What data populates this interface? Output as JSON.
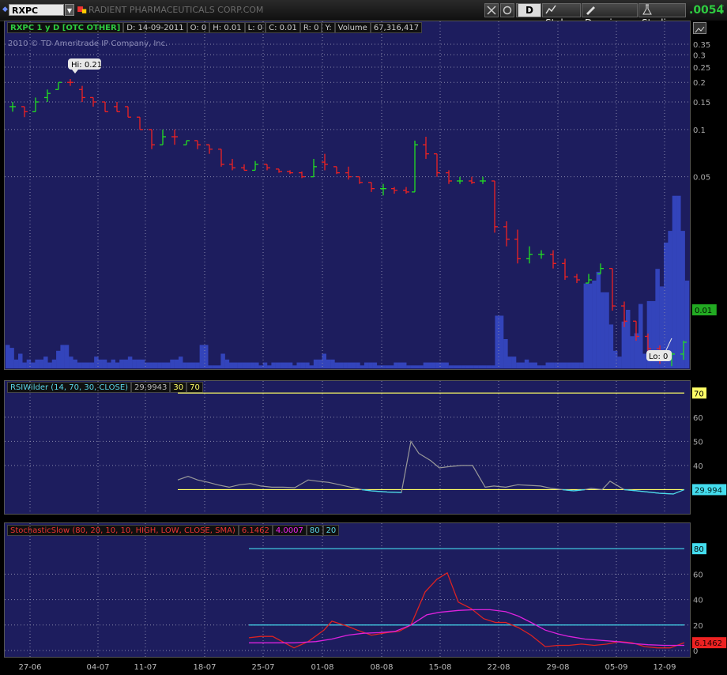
{
  "toolbar": {
    "symbol": "RXPC",
    "company": "RADIENT PHARMACEUTICALS CORP.COM",
    "period_button": "D",
    "style_label": "Style",
    "drawings_label": "Drawings",
    "studies_label": "Studies",
    "last_price": ".0054"
  },
  "header": {
    "title": "RXPC 1 y D [OTC OTHER]",
    "date": "D: 14-09-2011",
    "open": "O: 0",
    "high": "H: 0.01",
    "low": "L: 0",
    "close": "C: 0.01",
    "r": "R: 0",
    "y": "Y:",
    "volume_label": "Volume",
    "volume_value": "67,316,417",
    "copyright": "2010 © TD Ameritrade IP Company, Inc."
  },
  "colors": {
    "panel_bg": "#1d1d5e",
    "up": "#22dd22",
    "down": "#ee2222",
    "volume": "#3344bb",
    "rsi_line": "#999999",
    "stoch_k": "#dd2222",
    "stoch_d": "#dd22dd",
    "threshold_yellow": "#ffff66",
    "threshold_cyan": "#44ddee"
  },
  "chart_data": [
    {
      "type": "ohlc",
      "name": "price",
      "x_ticks": [
        "27-06",
        "04-07",
        "11-07",
        "18-07",
        "25-07",
        "01-08",
        "08-08",
        "15-08",
        "22-08",
        "29-08",
        "05-09",
        "12-09"
      ],
      "y_ticks": [
        "0.35",
        "0.3",
        "0.25",
        "0.2",
        "0.15",
        "0.1",
        "0.05"
      ],
      "y_scale": "log",
      "annotations": {
        "hi": "Hi: 0.21",
        "lo": "Lo: 0"
      },
      "last_label": "0.01",
      "candles": [
        {
          "x": 16,
          "o": 0.14,
          "h": 0.15,
          "l": 0.13,
          "c": 0.14,
          "u": 1
        },
        {
          "x": 31,
          "o": 0.14,
          "h": 0.14,
          "l": 0.12,
          "c": 0.13,
          "u": 0
        },
        {
          "x": 45,
          "o": 0.13,
          "h": 0.16,
          "l": 0.13,
          "c": 0.15,
          "u": 1
        },
        {
          "x": 60,
          "o": 0.16,
          "h": 0.18,
          "l": 0.15,
          "c": 0.17,
          "u": 1
        },
        {
          "x": 74,
          "o": 0.18,
          "h": 0.2,
          "l": 0.18,
          "c": 0.2,
          "u": 1
        },
        {
          "x": 89,
          "o": 0.2,
          "h": 0.21,
          "l": 0.19,
          "c": 0.2,
          "u": 0
        },
        {
          "x": 104,
          "o": 0.18,
          "h": 0.19,
          "l": 0.15,
          "c": 0.16,
          "u": 0
        },
        {
          "x": 118,
          "o": 0.16,
          "h": 0.16,
          "l": 0.14,
          "c": 0.15,
          "u": 0
        },
        {
          "x": 133,
          "o": 0.15,
          "h": 0.15,
          "l": 0.13,
          "c": 0.13,
          "u": 0
        },
        {
          "x": 148,
          "o": 0.14,
          "h": 0.15,
          "l": 0.13,
          "c": 0.13,
          "u": 0
        },
        {
          "x": 162,
          "o": 0.14,
          "h": 0.14,
          "l": 0.12,
          "c": 0.12,
          "u": 0
        },
        {
          "x": 177,
          "o": 0.12,
          "h": 0.12,
          "l": 0.1,
          "c": 0.1,
          "u": 0
        },
        {
          "x": 192,
          "o": 0.1,
          "h": 0.1,
          "l": 0.075,
          "c": 0.08,
          "u": 0
        },
        {
          "x": 206,
          "o": 0.08,
          "h": 0.1,
          "l": 0.08,
          "c": 0.09,
          "u": 1
        },
        {
          "x": 221,
          "o": 0.09,
          "h": 0.1,
          "l": 0.08,
          "c": 0.09,
          "u": 0
        },
        {
          "x": 236,
          "o": 0.08,
          "h": 0.085,
          "l": 0.08,
          "c": 0.085,
          "u": 1
        },
        {
          "x": 250,
          "o": 0.085,
          "h": 0.085,
          "l": 0.075,
          "c": 0.08,
          "u": 0
        },
        {
          "x": 265,
          "o": 0.08,
          "h": 0.08,
          "l": 0.07,
          "c": 0.075,
          "u": 0
        },
        {
          "x": 280,
          "o": 0.075,
          "h": 0.075,
          "l": 0.058,
          "c": 0.06,
          "u": 0
        },
        {
          "x": 294,
          "o": 0.06,
          "h": 0.065,
          "l": 0.055,
          "c": 0.057,
          "u": 0
        },
        {
          "x": 309,
          "o": 0.057,
          "h": 0.06,
          "l": 0.055,
          "c": 0.055,
          "u": 0
        },
        {
          "x": 323,
          "o": 0.055,
          "h": 0.063,
          "l": 0.055,
          "c": 0.06,
          "u": 1
        },
        {
          "x": 338,
          "o": 0.06,
          "h": 0.06,
          "l": 0.055,
          "c": 0.057,
          "u": 0
        },
        {
          "x": 353,
          "o": 0.056,
          "h": 0.056,
          "l": 0.053,
          "c": 0.054,
          "u": 0
        },
        {
          "x": 367,
          "o": 0.054,
          "h": 0.055,
          "l": 0.052,
          "c": 0.053,
          "u": 0
        },
        {
          "x": 382,
          "o": 0.053,
          "h": 0.054,
          "l": 0.049,
          "c": 0.05,
          "u": 0
        },
        {
          "x": 397,
          "o": 0.05,
          "h": 0.065,
          "l": 0.05,
          "c": 0.058,
          "u": 1
        },
        {
          "x": 411,
          "o": 0.062,
          "h": 0.07,
          "l": 0.055,
          "c": 0.06,
          "u": 0
        },
        {
          "x": 426,
          "o": 0.058,
          "h": 0.058,
          "l": 0.052,
          "c": 0.053,
          "u": 0
        },
        {
          "x": 441,
          "o": 0.053,
          "h": 0.058,
          "l": 0.048,
          "c": 0.05,
          "u": 0
        },
        {
          "x": 455,
          "o": 0.05,
          "h": 0.05,
          "l": 0.045,
          "c": 0.046,
          "u": 0
        },
        {
          "x": 470,
          "o": 0.046,
          "h": 0.046,
          "l": 0.04,
          "c": 0.042,
          "u": 0
        },
        {
          "x": 485,
          "o": 0.042,
          "h": 0.045,
          "l": 0.038,
          "c": 0.042,
          "u": 1
        },
        {
          "x": 499,
          "o": 0.042,
          "h": 0.043,
          "l": 0.039,
          "c": 0.041,
          "u": 0
        },
        {
          "x": 514,
          "o": 0.041,
          "h": 0.043,
          "l": 0.039,
          "c": 0.04,
          "u": 0
        },
        {
          "x": 525,
          "o": 0.04,
          "h": 0.085,
          "l": 0.04,
          "c": 0.08,
          "u": 1
        },
        {
          "x": 539,
          "o": 0.08,
          "h": 0.09,
          "l": 0.065,
          "c": 0.07,
          "u": 0
        },
        {
          "x": 553,
          "o": 0.07,
          "h": 0.07,
          "l": 0.05,
          "c": 0.053,
          "u": 0
        },
        {
          "x": 568,
          "o": 0.053,
          "h": 0.055,
          "l": 0.045,
          "c": 0.047,
          "u": 0
        },
        {
          "x": 582,
          "o": 0.047,
          "h": 0.05,
          "l": 0.045,
          "c": 0.047,
          "u": 1
        },
        {
          "x": 597,
          "o": 0.047,
          "h": 0.05,
          "l": 0.045,
          "c": 0.046,
          "u": 0
        },
        {
          "x": 611,
          "o": 0.047,
          "h": 0.05,
          "l": 0.045,
          "c": 0.047,
          "u": 1
        },
        {
          "x": 626,
          "o": 0.047,
          "h": 0.047,
          "l": 0.022,
          "c": 0.024,
          "u": 0
        },
        {
          "x": 641,
          "o": 0.024,
          "h": 0.026,
          "l": 0.018,
          "c": 0.02,
          "u": 0
        },
        {
          "x": 655,
          "o": 0.02,
          "h": 0.023,
          "l": 0.014,
          "c": 0.015,
          "u": 0
        },
        {
          "x": 670,
          "o": 0.015,
          "h": 0.018,
          "l": 0.014,
          "c": 0.016,
          "u": 1
        },
        {
          "x": 685,
          "o": 0.016,
          "h": 0.017,
          "l": 0.015,
          "c": 0.016,
          "u": 1
        },
        {
          "x": 700,
          "o": 0.016,
          "h": 0.017,
          "l": 0.013,
          "c": 0.014,
          "u": 0
        },
        {
          "x": 715,
          "o": 0.014,
          "h": 0.015,
          "l": 0.011,
          "c": 0.0115,
          "u": 0
        },
        {
          "x": 730,
          "o": 0.0115,
          "h": 0.012,
          "l": 0.0105,
          "c": 0.011,
          "u": 0
        },
        {
          "x": 745,
          "o": 0.0105,
          "h": 0.012,
          "l": 0.0105,
          "c": 0.011,
          "u": 1
        },
        {
          "x": 760,
          "o": 0.012,
          "h": 0.014,
          "l": 0.012,
          "c": 0.013,
          "u": 1
        },
        {
          "x": 775,
          "o": 0.013,
          "h": 0.013,
          "l": 0.007,
          "c": 0.0075,
          "u": 0
        },
        {
          "x": 790,
          "o": 0.0075,
          "h": 0.008,
          "l": 0.0055,
          "c": 0.006,
          "u": 0
        },
        {
          "x": 805,
          "o": 0.006,
          "h": 0.006,
          "l": 0.0045,
          "c": 0.0048,
          "u": 0
        },
        {
          "x": 820,
          "o": 0.0048,
          "h": 0.005,
          "l": 0.0038,
          "c": 0.004,
          "u": 0
        },
        {
          "x": 835,
          "o": 0.004,
          "h": 0.0042,
          "l": 0.0032,
          "c": 0.0035,
          "u": 0
        },
        {
          "x": 850,
          "o": 0.0035,
          "h": 0.0038,
          "l": 0.0031,
          "c": 0.0037,
          "u": 1
        },
        {
          "x": 865,
          "o": 0.0037,
          "h": 0.0045,
          "l": 0.0034,
          "c": 0.0044,
          "u": 1
        }
      ]
    },
    {
      "type": "bar",
      "name": "volume",
      "values": [
        8,
        7,
        3,
        5,
        2,
        3,
        2,
        3,
        3,
        4,
        2,
        3,
        6,
        8,
        8,
        4,
        3,
        2,
        2,
        2,
        2,
        4,
        3,
        3,
        2,
        3,
        2,
        3,
        3,
        4,
        3,
        3,
        3,
        2,
        2,
        2,
        2,
        2,
        2,
        3,
        3,
        4,
        2,
        2,
        2,
        2,
        8,
        8,
        1,
        1,
        1,
        5,
        3,
        2,
        2,
        2,
        2,
        2,
        2,
        2,
        1,
        2,
        1,
        2,
        2,
        2,
        2,
        2,
        1,
        2,
        2,
        2,
        1,
        3,
        3,
        5,
        3,
        3,
        2,
        2,
        2,
        2,
        2,
        2,
        1,
        2,
        2,
        2,
        1,
        1,
        1,
        1,
        2,
        2,
        2,
        1,
        1,
        1,
        1,
        2,
        2,
        2,
        2,
        2,
        2,
        1,
        1,
        1,
        1,
        1,
        1,
        1,
        1,
        1,
        1,
        1,
        18,
        18,
        10,
        4,
        4,
        2,
        2,
        3,
        2,
        2,
        1,
        1,
        2,
        2,
        2,
        2,
        2,
        2,
        2,
        2,
        2,
        29,
        29,
        30,
        33,
        26,
        26,
        15,
        6,
        4,
        16,
        20,
        11,
        12,
        22,
        5,
        23,
        23,
        34,
        28,
        43,
        47,
        59,
        59,
        47,
        30
      ]
    },
    {
      "type": "line",
      "name": "RSIWilder",
      "legend": [
        "RSIWilder (14, 70, 30, CLOSE)",
        "29.9943",
        "30",
        "70"
      ],
      "y_ticks": [
        "60",
        "50",
        "40"
      ],
      "thresholds": [
        {
          "value": 70,
          "label": "70"
        },
        {
          "value": 30,
          "label": "30"
        }
      ],
      "last_label": "29.994",
      "x": [
        225,
        238,
        250,
        264,
        275,
        290,
        303,
        317,
        330,
        344,
        358,
        373,
        390,
        402,
        416,
        430,
        444,
        458,
        470,
        490,
        508,
        520,
        530,
        545,
        556,
        568,
        584,
        598,
        614,
        625,
        640,
        655,
        668,
        684,
        698,
        712,
        726,
        740,
        748,
        762,
        772,
        790,
        806,
        820,
        834,
        852,
        866
      ],
      "y": [
        34,
        35.5,
        34,
        33,
        32,
        31,
        32,
        32.5,
        31.5,
        31,
        31,
        30.8,
        34,
        33.5,
        33,
        32,
        31,
        30,
        29.5,
        29,
        28.8,
        50,
        45,
        42,
        39,
        39.5,
        40,
        40,
        31,
        31.5,
        31,
        32,
        31.8,
        31.5,
        30.5,
        30,
        29.5,
        30,
        30.5,
        30,
        33.5,
        30,
        29.5,
        29,
        28.5,
        28.2,
        29.99
      ]
    },
    {
      "type": "line",
      "name": "StochasticSlow",
      "legend": [
        "StochasticSlow (80, 20, 10, 10, HIGH, LOW, CLOSE, SMA)",
        "6.1462",
        "4.0007",
        "80",
        "20"
      ],
      "y_ticks": [
        "60",
        "40",
        "20",
        "0"
      ],
      "thresholds": [
        {
          "value": 80,
          "label": "80"
        },
        {
          "value": 20,
          "label": "20"
        }
      ],
      "last_label": "6.1462",
      "series": [
        {
          "name": "6.1462",
          "x": [
            315,
            330,
            345,
            372,
            390,
            410,
            420,
            440,
            452,
            470,
            490,
            505,
            520,
            538,
            553,
            566,
            580,
            596,
            612,
            627,
            640,
            656,
            672,
            690,
            706,
            720,
            736,
            752,
            768,
            784,
            800,
            816,
            832,
            848,
            866
          ],
          "y": [
            10,
            11,
            11,
            2,
            7,
            16,
            23,
            19,
            16,
            12,
            14,
            15,
            20,
            46,
            56,
            61,
            38,
            33,
            25,
            22,
            22,
            18,
            12,
            3,
            4,
            4,
            5,
            4,
            5,
            7,
            6,
            3,
            2,
            2,
            6.1
          ]
        },
        {
          "name": "4.0007",
          "x": [
            315,
            345,
            372,
            400,
            420,
            440,
            460,
            480,
            500,
            520,
            540,
            556,
            580,
            600,
            620,
            640,
            656,
            672,
            690,
            706,
            720,
            740,
            760,
            780,
            800,
            820,
            840,
            866
          ],
          "y": [
            6,
            6,
            6,
            7,
            9,
            12,
            13.5,
            14,
            15,
            20,
            28,
            30,
            31.5,
            32,
            32,
            30.5,
            27,
            22,
            16,
            13,
            11,
            9,
            8,
            7,
            5.5,
            4.5,
            4,
            4
          ]
        }
      ]
    }
  ]
}
